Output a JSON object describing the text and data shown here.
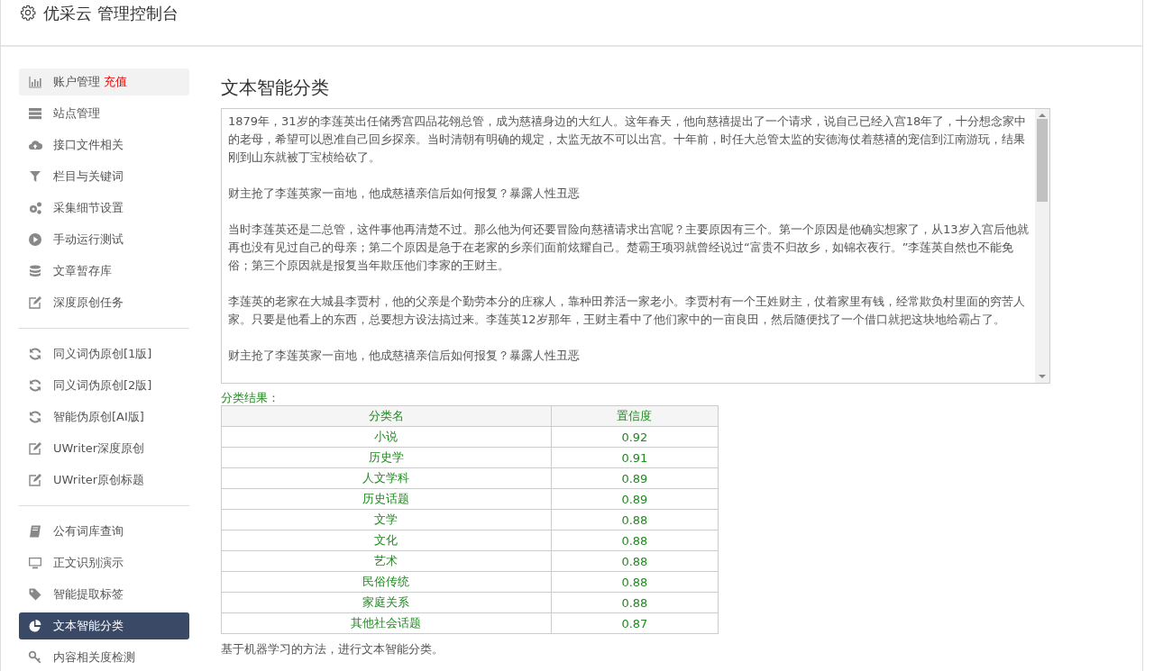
{
  "header": {
    "title": "优采云 管理控制台"
  },
  "sidebar": {
    "groups": [
      [
        {
          "label": "账户管理",
          "badge": "充值",
          "highlighted": true,
          "selected": false
        },
        {
          "label": "站点管理",
          "highlighted": false,
          "selected": false
        },
        {
          "label": "接口文件相关",
          "highlighted": false,
          "selected": false
        },
        {
          "label": "栏目与关键词",
          "highlighted": false,
          "selected": false
        },
        {
          "label": "采集细节设置",
          "highlighted": false,
          "selected": false
        },
        {
          "label": "手动运行测试",
          "highlighted": false,
          "selected": false
        },
        {
          "label": "文章暂存库",
          "highlighted": false,
          "selected": false
        },
        {
          "label": "深度原创任务",
          "highlighted": false,
          "selected": false
        }
      ],
      [
        {
          "label": "同义词伪原创[1版]",
          "highlighted": false,
          "selected": false
        },
        {
          "label": "同义词伪原创[2版]",
          "highlighted": false,
          "selected": false
        },
        {
          "label": "智能伪原创[AI版]",
          "highlighted": false,
          "selected": false
        },
        {
          "label": "UWriter深度原创",
          "highlighted": false,
          "selected": false
        },
        {
          "label": "UWriter原创标题",
          "highlighted": false,
          "selected": false
        }
      ],
      [
        {
          "label": "公有词库查询",
          "highlighted": false,
          "selected": false
        },
        {
          "label": "正文识别演示",
          "highlighted": false,
          "selected": false
        },
        {
          "label": "智能提取标签",
          "highlighted": false,
          "selected": false
        },
        {
          "label": "文本智能分类",
          "highlighted": false,
          "selected": true
        },
        {
          "label": "内容相关度检测",
          "highlighted": false,
          "selected": false
        }
      ]
    ]
  },
  "main": {
    "title": "文本智能分类",
    "text_input": {
      "paragraphs": [
        "1879年，31岁的李莲英出任储秀宫四品花翎总管，成为慈禧身边的大红人。这年春天，他向慈禧提出了一个请求，说自己已经入宫18年了，十分想念家中的老母，希望可以恩准自己回乡探亲。当时清朝有明确的规定，太监无故不可以出宫。十年前，时任大总管太监的安德海仗着慈禧的宠信到江南游玩，结果刚到山东就被丁宝桢给砍了。",
        "财主抢了李莲英家一亩地，他成慈禧亲信后如何报复？暴露人性丑恶",
        "当时李莲英还是二总管，这件事他再清楚不过。那么他为何还要冒险向慈禧请求出宫呢？主要原因有三个。第一个原因是他确实想家了，从13岁入宫后他就再也没有见过自己的母亲；第二个原因是急于在老家的乡亲们面前炫耀自己。楚霸王项羽就曾经说过“富贵不归故乡，如锦衣夜行。”李莲英自然也不能免俗；第三个原因就是报复当年欺压他们李家的王财主。",
        "李莲英的老家在大城县李贾村，他的父亲是个勤劳本分的庄稼人，靠种田养活一家老小。李贾村有一个王姓财主，仗着家里有钱，经常欺负村里面的穷苦人家。只要是他看上的东西，总要想方设法搞过来。李莲英12岁那年，王财主看中了他们家中的一亩良田，然后随便找了一个借口就把这块地给霸占了。",
        "财主抢了李莲英家一亩地，他成慈禧亲信后如何报复？暴露人性丑恶"
      ]
    },
    "result_label": "分类结果：",
    "table": {
      "columns": [
        "分类名",
        "置信度"
      ],
      "rows": [
        [
          "小说",
          "0.92"
        ],
        [
          "历史学",
          "0.91"
        ],
        [
          "人文学科",
          "0.89"
        ],
        [
          "历史话题",
          "0.89"
        ],
        [
          "文学",
          "0.88"
        ],
        [
          "文化",
          "0.88"
        ],
        [
          "艺术",
          "0.88"
        ],
        [
          "民俗传统",
          "0.88"
        ],
        [
          "家庭关系",
          "0.88"
        ],
        [
          "其他社会话题",
          "0.87"
        ]
      ]
    },
    "note": "基于机器学习的方法，进行文本智能分类。"
  }
}
